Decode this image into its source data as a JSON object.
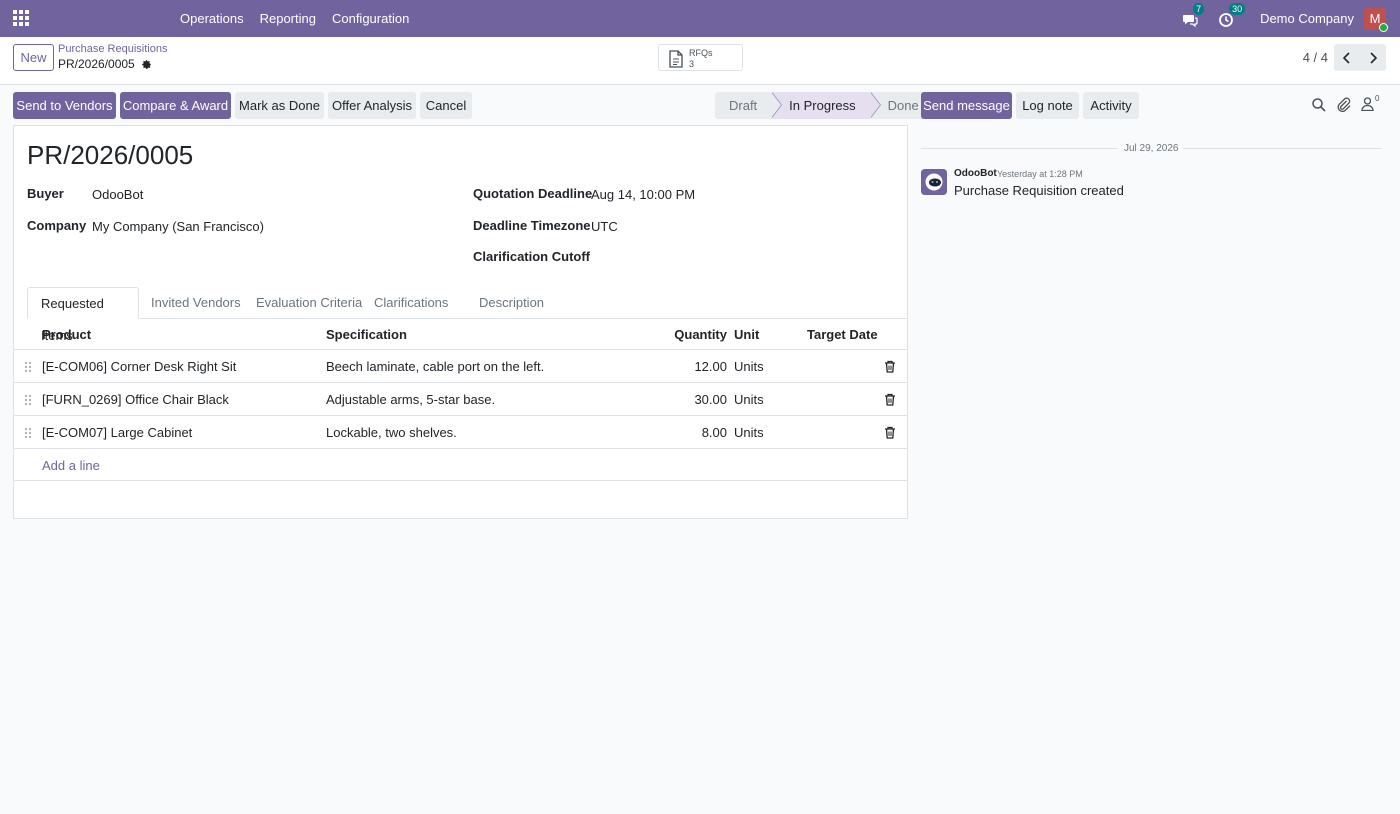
{
  "nav": {
    "menu": [
      "Operations",
      "Reporting",
      "Configuration"
    ],
    "messages_count": "7",
    "activities_count": "30",
    "company": "Demo Company",
    "avatar_initial": "M"
  },
  "control": {
    "new_label": "New",
    "breadcrumb": "Purchase Requisitions",
    "record_name": "PR/2026/0005",
    "smart_label": "RFQs",
    "smart_value": "3",
    "pager": "4 / 4"
  },
  "actions": {
    "send_to_vendors": "Send to Vendors",
    "compare_award": "Compare & Award",
    "mark_done": "Mark as Done",
    "offer_analysis": "Offer Analysis",
    "cancel": "Cancel"
  },
  "status": {
    "stages": [
      "Draft",
      "In Progress",
      "Done"
    ],
    "active": "In Progress"
  },
  "form": {
    "title": "PR/2026/0005",
    "buyer_label": "Buyer",
    "buyer_value": "OdooBot",
    "company_label": "Company",
    "company_value": "My Company (San Francisco)",
    "deadline_label": "Quotation Deadline",
    "deadline_value": "Aug 14, 10:00 PM",
    "timezone_label": "Deadline Timezone",
    "timezone_value": "UTC",
    "cutoff_label": "Clarification Cutoff",
    "cutoff_value": ""
  },
  "tabs": [
    "Requested Items",
    "Invited Vendors",
    "Evaluation Criteria",
    "Clarifications",
    "Description"
  ],
  "table": {
    "headers": {
      "product": "Product",
      "specification": "Specification",
      "quantity": "Quantity",
      "unit": "Unit",
      "target_date": "Target Date"
    },
    "rows": [
      {
        "product": "[E-COM06] Corner Desk Right Sit",
        "specification": "Beech laminate, cable port on the left.",
        "quantity": "12.00",
        "unit": "Units",
        "target_date": ""
      },
      {
        "product": "[FURN_0269] Office Chair Black",
        "specification": "Adjustable arms, 5-star base.",
        "quantity": "30.00",
        "unit": "Units",
        "target_date": ""
      },
      {
        "product": "[E-COM07] Large Cabinet",
        "specification": "Lockable, two shelves.",
        "quantity": "8.00",
        "unit": "Units",
        "target_date": ""
      }
    ],
    "add_line": "Add a line"
  },
  "chatter": {
    "send_message": "Send message",
    "log_note": "Log note",
    "activity": "Activity",
    "followers_count": "0",
    "date": "Jul 29, 2026",
    "message": {
      "author": "OdooBot",
      "time": "Yesterday at 1:28 PM",
      "body": "Purchase Requisition created"
    }
  }
}
